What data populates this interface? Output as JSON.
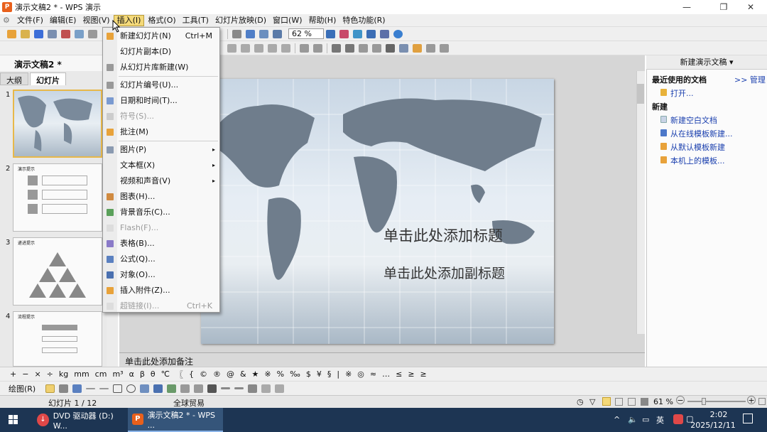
{
  "window": {
    "title": "演示文稿2 * - WPS 演示",
    "app_icon": "P"
  },
  "menubar": [
    "文件(F)",
    "编辑(E)",
    "视图(V)",
    "插入(I)",
    "格式(O)",
    "工具(T)",
    "幻灯片放映(D)",
    "窗口(W)",
    "帮助(H)",
    "特色功能(R)"
  ],
  "toolbar": {
    "zoom": "62 %"
  },
  "left_panel": {
    "doc_title": "演示文稿2 *",
    "tabs": [
      "大纲",
      "幻灯片"
    ],
    "thumb_titles": [
      "",
      "演示提示",
      "递进提示",
      "流程提示"
    ],
    "thumb_numbers": [
      "1",
      "2",
      "3",
      "4"
    ]
  },
  "insert_menu": [
    {
      "label": "新建幻灯片(N)",
      "shortcut": "Ctrl+M",
      "enabled": true
    },
    {
      "label": "幻灯片副本(D)",
      "enabled": true
    },
    {
      "label": "从幻灯片库新建(W)",
      "enabled": true
    },
    {
      "label": "幻灯片编号(U)...",
      "enabled": true
    },
    {
      "label": "日期和时间(T)...",
      "enabled": true
    },
    {
      "label": "符号(S)...",
      "enabled": false
    },
    {
      "label": "批注(M)",
      "enabled": true
    },
    {
      "label": "图片(P)",
      "submenu": true,
      "enabled": true
    },
    {
      "label": "文本框(X)",
      "submenu": true,
      "enabled": true
    },
    {
      "label": "视频和声音(V)",
      "submenu": true,
      "enabled": true
    },
    {
      "label": "图表(H)...",
      "enabled": true
    },
    {
      "label": "背景音乐(C)...",
      "enabled": true
    },
    {
      "label": "Flash(F)...",
      "enabled": false
    },
    {
      "label": "表格(B)...",
      "enabled": true
    },
    {
      "label": "公式(Q)...",
      "enabled": true
    },
    {
      "label": "对象(O)...",
      "enabled": true
    },
    {
      "label": "插入附件(Z)...",
      "enabled": true
    },
    {
      "label": "超链接(I)...",
      "shortcut": "Ctrl+K",
      "enabled": false
    }
  ],
  "slide": {
    "title_placeholder": "单击此处添加标题",
    "subtitle_placeholder": "单击此处添加副标题"
  },
  "notes": "单击此处添加备注",
  "right_panel": {
    "header": "新建演示文稿 ▾",
    "recent_title": "最近使用的文档",
    "manage_link": ">> 管理",
    "open_link": "打开...",
    "new_title": "新建",
    "new_links": [
      "新建空白文档",
      "从在线模板新建...",
      "从默认模板新建",
      "本机上的模板..."
    ]
  },
  "symbols": [
    "+",
    "−",
    "×",
    "÷",
    "kg",
    "mm",
    "cm",
    "m³",
    "α",
    "β",
    "θ",
    "℃",
    "〖",
    "{",
    "©",
    "®",
    "@",
    "&",
    "★",
    "※",
    "%",
    "‰",
    "$",
    "¥",
    "§",
    "|",
    "※",
    "◎",
    "≈",
    "…",
    "≤",
    "≥",
    "≥"
  ],
  "drawbar": {
    "label": "绘图(R)"
  },
  "statusbar": {
    "slide_info": "幻灯片 1 / 12",
    "template": "全球贸易",
    "zoom": "61 %"
  },
  "taskbar": {
    "tasks": [
      "DVD 驱动器 (D:) W...",
      "演示文稿2 * - WPS ..."
    ],
    "tray_lang": "英",
    "time": "2:02",
    "date": "2025/12/11"
  },
  "colors": {
    "accent": "#f4d979",
    "title_bar_icon": "#e8601c",
    "link": "#1a3fae",
    "taskbar": "#1d3553"
  }
}
